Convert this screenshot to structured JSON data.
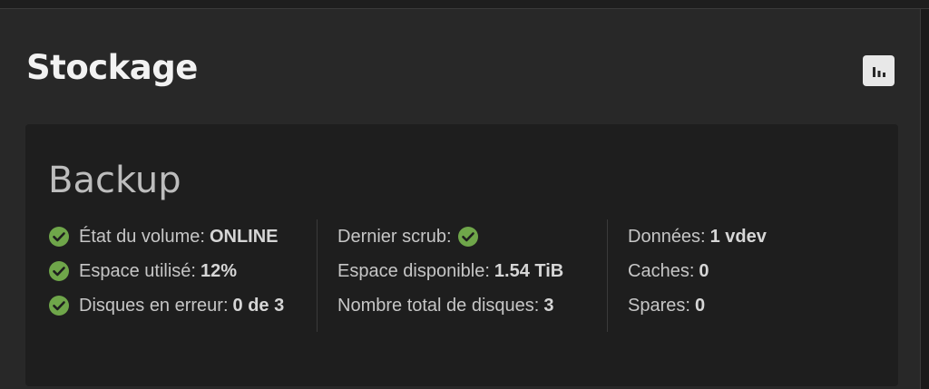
{
  "card": {
    "title": "Stockage",
    "stats_icon": "bar-chart-icon"
  },
  "pool": {
    "name": "Backup",
    "columns": [
      [
        {
          "label": "État du volume:",
          "value": "ONLINE",
          "icon": "check-circle-icon"
        },
        {
          "label": "Espace utilisé:",
          "value": "12%",
          "icon": "check-circle-icon"
        },
        {
          "label": "Disques en erreur:",
          "value": "0 de 3",
          "icon": "check-circle-icon"
        }
      ],
      [
        {
          "label": "Dernier scrub:",
          "value": "",
          "icon": "check-circle-icon"
        },
        {
          "label": "Espace disponible:",
          "value": "1.54 TiB"
        },
        {
          "label": "Nombre total de disques:",
          "value": "3"
        }
      ],
      [
        {
          "label": "Données:",
          "value": "1 vdev"
        },
        {
          "label": "Caches:",
          "value": "0"
        },
        {
          "label": "Spares:",
          "value": "0"
        }
      ]
    ]
  },
  "colors": {
    "ok_green": "#6fa64a",
    "card_bg": "#282828",
    "pool_bg": "#1e1e1e",
    "page_bg": "#1a1a1a"
  }
}
